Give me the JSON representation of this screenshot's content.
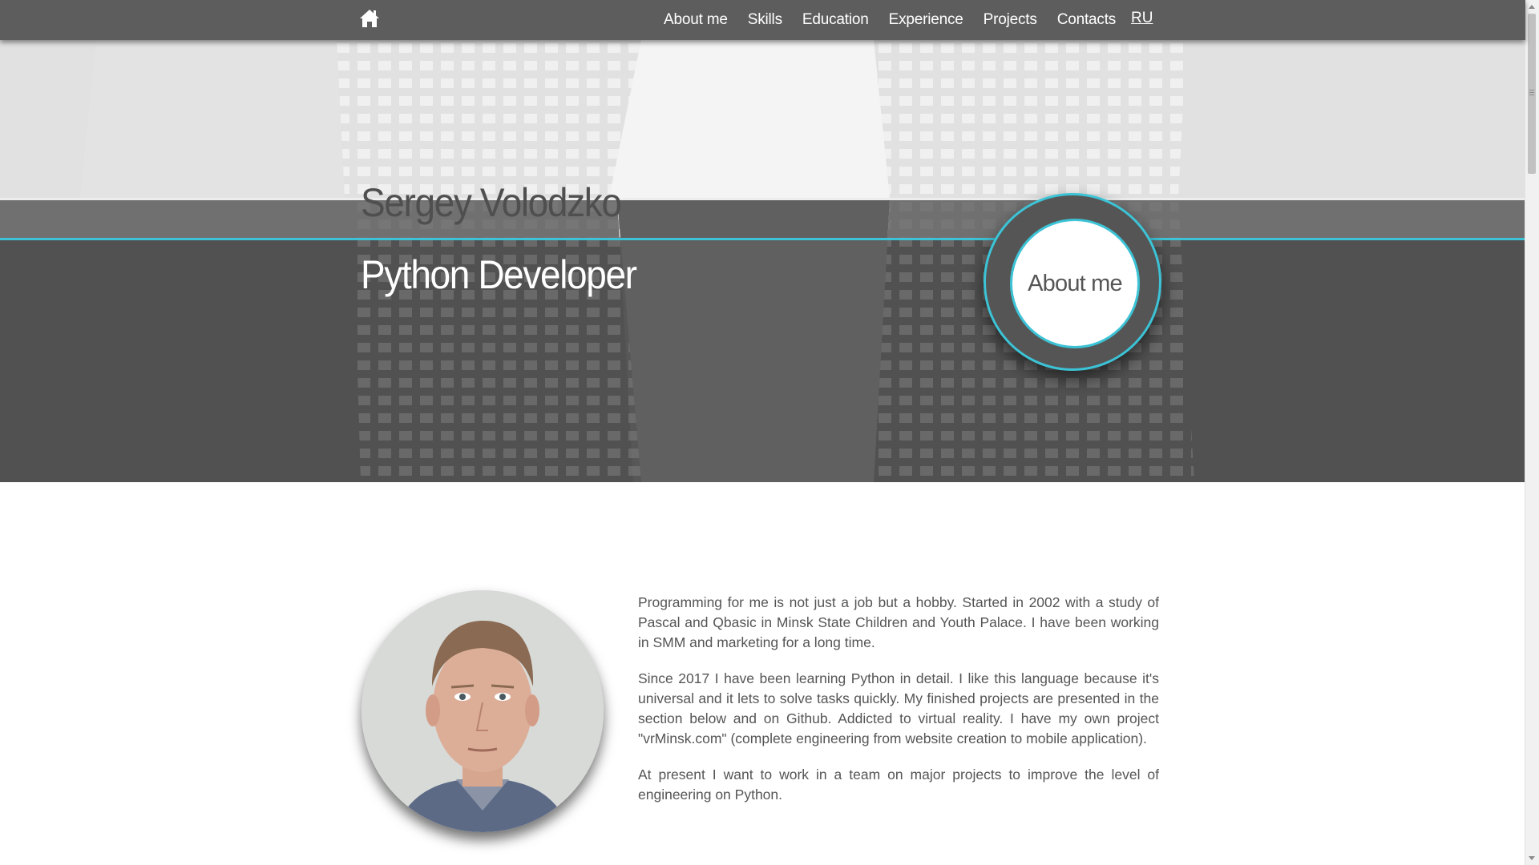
{
  "nav": {
    "home_icon": "home-icon",
    "items": [
      "About me",
      "Skills",
      "Education",
      "Experience",
      "Projects",
      "Contacts"
    ],
    "language": "RU"
  },
  "hero": {
    "name": "Sergey Volodzko",
    "role": "Python Developer",
    "badge_label": "About me"
  },
  "about": {
    "paragraphs": [
      "Programming for me is not just a job but a hobby. Started in 2002 with a study of Pascal and Qbasic in Minsk State Children and Youth Palace. I have been working in SMM and marketing for a long time.",
      "Since 2017 I have been learning Python in detail. I like this language because it's universal and it lets to solve tasks quickly. My finished projects are presented in the section below and on Github. Addicted to virtual reality. I have my own project \"vrMinsk.com\" (complete engineering from website creation to mobile application).",
      "At present I want to work in a team on major projects to improve the level of engineering on Python."
    ]
  },
  "colors": {
    "nav_bg": "#5d5d5d",
    "accent": "#3cc3d6",
    "hero_dark": "#575757",
    "hero_light": "#ededed"
  }
}
